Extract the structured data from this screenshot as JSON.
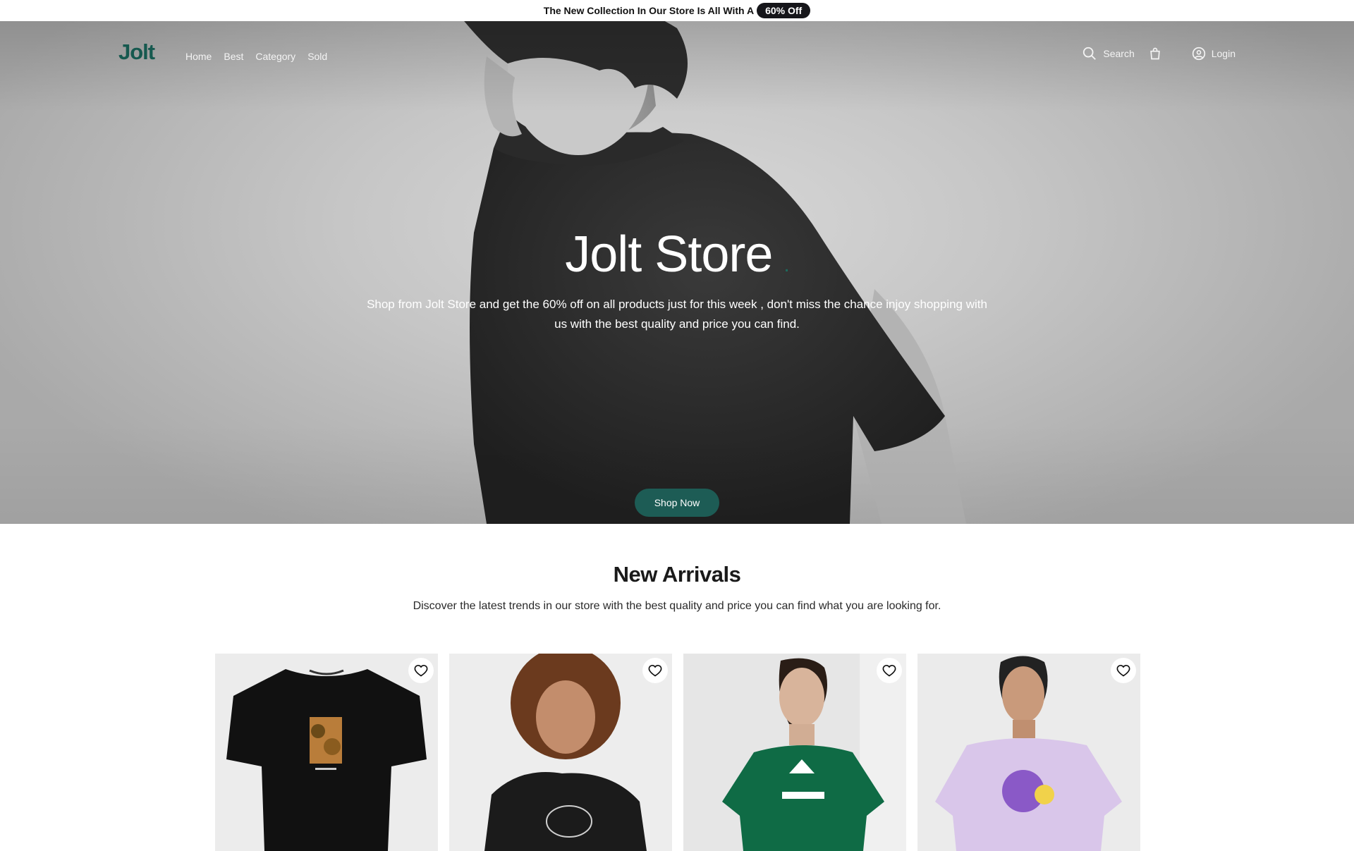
{
  "announcement": {
    "text": "The New Collection In Our Store Is All With A",
    "badge": "60% Off"
  },
  "nav": {
    "logo": "Jolt",
    "links": [
      "Home",
      "Best",
      "Category",
      "Sold"
    ],
    "search_label": "Search",
    "login_label": "Login",
    "icons": [
      "search-icon",
      "shopping-bag-icon",
      "user-circle-icon"
    ]
  },
  "hero": {
    "title": "Jolt Store",
    "title_dot": ".",
    "subtitle": "Shop from Jolt Store and get the 60% off on all products just for this week , don't miss the chance injoy shopping with us with the best quality and price you can find.",
    "cta": "Shop Now"
  },
  "arrivals": {
    "title": "New Arrivals",
    "subtitle": "Discover the latest trends in our store with the best quality and price you can find what you are looking for."
  },
  "products": [
    {
      "kind": "black-tshirt-sunflower-print",
      "favorite_icon": "heart-icon"
    },
    {
      "kind": "model-black-snoopy-sweatshirt",
      "favorite_icon": "heart-icon"
    },
    {
      "kind": "model-green-adidas-tshirt",
      "favorite_icon": "heart-icon"
    },
    {
      "kind": "model-lilac-graphic-tshirt",
      "favorite_icon": "heart-icon"
    }
  ],
  "colors": {
    "brand": "#16594f",
    "cta": "#1d5c55",
    "badge_bg": "#16161a"
  }
}
